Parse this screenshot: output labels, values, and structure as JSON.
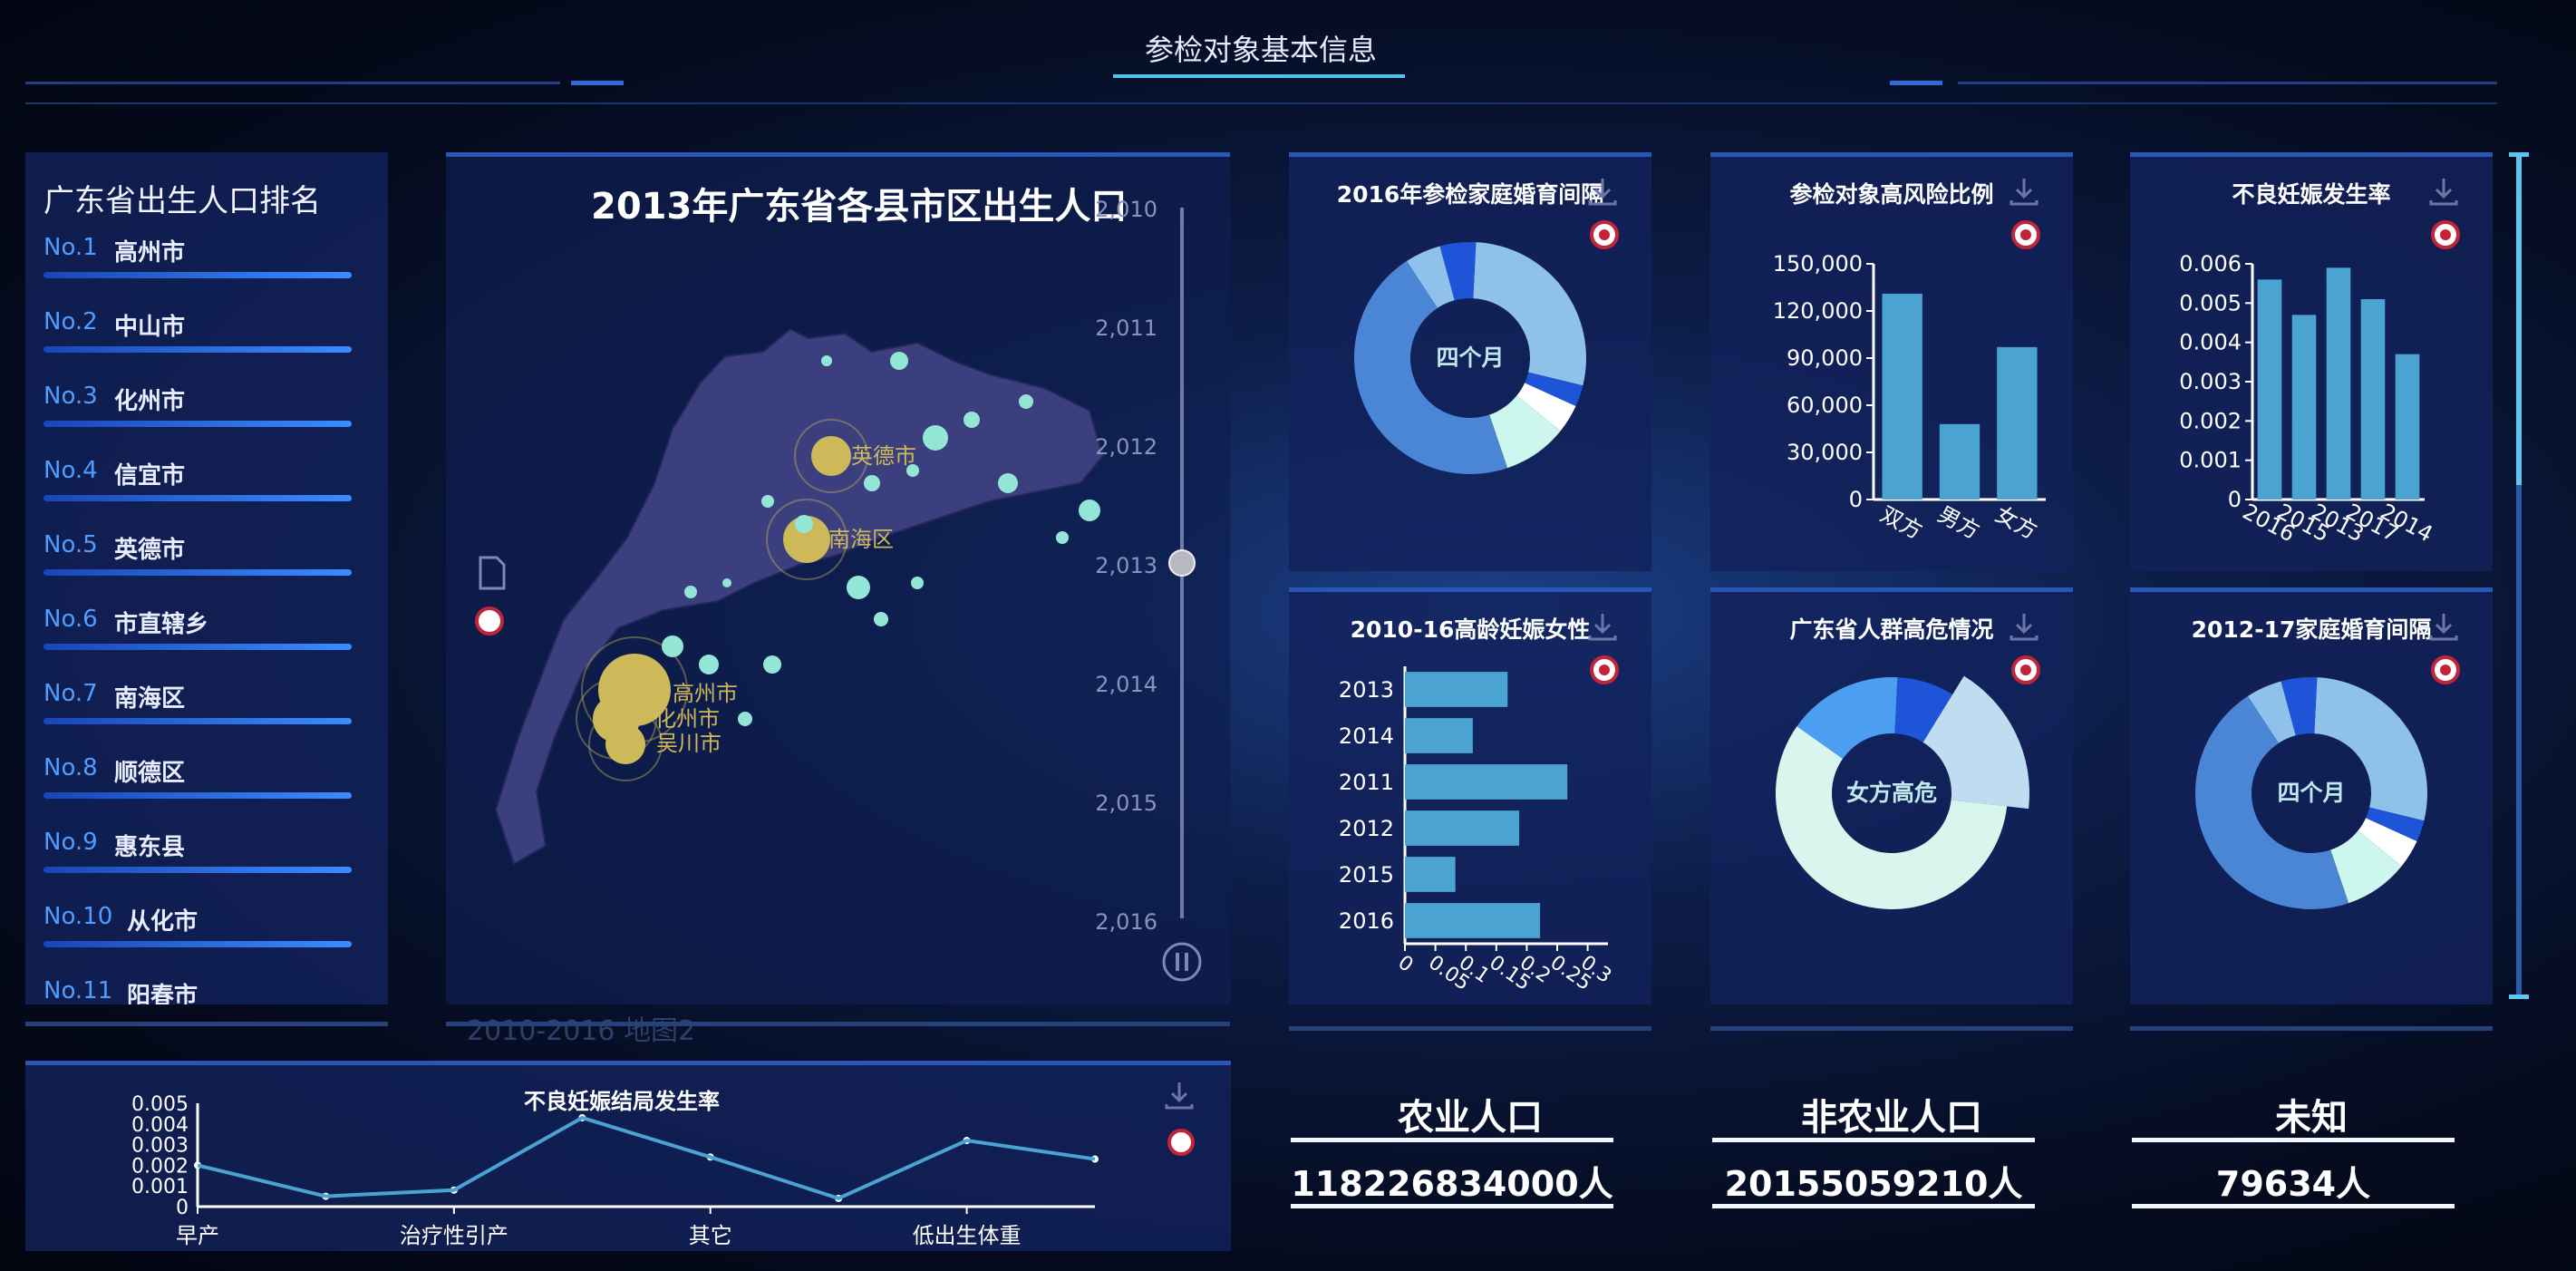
{
  "header": {
    "title": "参检对象基本信息"
  },
  "ranking": {
    "title": "广东省出生人口排名",
    "items": [
      {
        "no": "No.1",
        "city": "高州市"
      },
      {
        "no": "No.2",
        "city": "中山市"
      },
      {
        "no": "No.3",
        "city": "化州市"
      },
      {
        "no": "No.4",
        "city": "信宜市"
      },
      {
        "no": "No.5",
        "city": "英德市"
      },
      {
        "no": "No.6",
        "city": "市直辖乡"
      },
      {
        "no": "No.7",
        "city": "南海区"
      },
      {
        "no": "No.8",
        "city": "顺德区"
      },
      {
        "no": "No.9",
        "city": "惠东县"
      },
      {
        "no": "No.10",
        "city": "从化市"
      },
      {
        "no": "No.11",
        "city": "阳春市"
      }
    ]
  },
  "map": {
    "title": "2013年广东省各县市区出生人口",
    "timeline": [
      "2,010",
      "2,011",
      "2,012",
      "2,013",
      "2,014",
      "2,015",
      "2,016"
    ],
    "labels": [
      "英德市",
      "南海区",
      "高州市",
      "化州市",
      "吴川市"
    ],
    "caption": "2010-2016 地图2"
  },
  "colors": {
    "accent": "#2a56b8",
    "bar": "#4aa3d1",
    "gold": "#cdb85a",
    "teal": "#93e6d6"
  },
  "icons": {
    "download": "download-icon",
    "badge": "pin-badge-icon",
    "doc": "document-icon",
    "pause": "pause-icon"
  },
  "chart_data": [
    {
      "id": "marriage2016",
      "type": "pie",
      "title": "2016年参检家庭婚育间隔",
      "center_label": "四个月",
      "values": [
        28,
        3,
        4,
        9,
        46,
        5,
        5
      ],
      "colors": [
        "#8fc1ea",
        "#1e54d8",
        "#ffffff",
        "#ccf6ee",
        "#4b86d6",
        "#8fc1ea",
        "#1e54d8"
      ]
    },
    {
      "id": "risk",
      "type": "bar",
      "title": "参检对象高风险比例",
      "categories": [
        "双方",
        "男方",
        "女方"
      ],
      "values": [
        131000,
        48000,
        97000
      ],
      "ylim": [
        0,
        150000
      ],
      "yticks": [
        "0",
        "30,000",
        "60,000",
        "90,000",
        "120,000",
        "150,000"
      ]
    },
    {
      "id": "adverse",
      "type": "bar",
      "title": "不良妊娠发生率",
      "categories": [
        "2016",
        "2015",
        "2013",
        "2017",
        "2014"
      ],
      "values": [
        0.0056,
        0.0047,
        0.0059,
        0.0051,
        0.0037
      ],
      "ylim": [
        0,
        0.006
      ],
      "yticks": [
        "0",
        "0.001",
        "0.002",
        "0.003",
        "0.004",
        "0.005",
        "0.006"
      ]
    },
    {
      "id": "elderly",
      "type": "bar",
      "orientation": "horizontal",
      "title": "2010-16高龄妊娠女性",
      "categories": [
        "2013",
        "2014",
        "2011",
        "2012",
        "2015",
        "2016"
      ],
      "values": [
        0.177,
        0.117,
        0.28,
        0.197,
        0.087,
        0.233
      ],
      "xlim": [
        0,
        0.35
      ],
      "xticks": [
        "0",
        "0.05",
        "0.1",
        "0.15",
        "0.2",
        "0.25",
        "0.3"
      ]
    },
    {
      "id": "highrisk",
      "type": "pie",
      "title": "广东省人群高危情况",
      "center_label": "女方高危",
      "values": [
        8,
        18,
        58,
        16
      ],
      "colors": [
        "#1e54d8",
        "#c0dcf0",
        "#d8f6ee",
        "#4b9ef0"
      ]
    },
    {
      "id": "marriage1217",
      "type": "pie",
      "title": "2012-17家庭婚育间隔",
      "center_label": "四个月",
      "values": [
        28,
        3,
        4,
        9,
        46,
        5,
        5
      ],
      "colors": [
        "#8fc1ea",
        "#1e54d8",
        "#ffffff",
        "#ccf6ee",
        "#4b86d6",
        "#8fc1ea",
        "#1e54d8"
      ]
    },
    {
      "id": "outcome",
      "type": "line",
      "title": "不良妊娠结局发生率",
      "categories": [
        "早产",
        "",
        "治疗性引产",
        "",
        "其它",
        "",
        "低出生体重",
        ""
      ],
      "values": [
        0.002,
        0.0005,
        0.0008,
        0.0043,
        0.0024,
        0.0004,
        0.0032,
        0.0023
      ],
      "ylim": [
        0,
        0.005
      ],
      "yticks": [
        "0",
        "0.001",
        "0.002",
        "0.003",
        "0.004",
        "0.005"
      ]
    }
  ],
  "stats": [
    {
      "label": "农业人口",
      "value": "118226834000人"
    },
    {
      "label": "非农业人口",
      "value": "20155059210人"
    },
    {
      "label": "未知",
      "value": "79634人"
    }
  ]
}
